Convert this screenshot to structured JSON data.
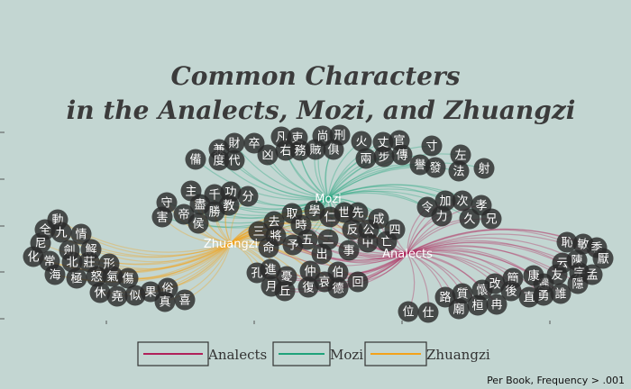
{
  "title_line1": "Common Characters",
  "title_line2": "in the Analects, Mozi, and Zhuangzi",
  "caption": "Per Book, Frequency > .001",
  "colors": {
    "background": "#c3d6d2",
    "analects": "#b0215a",
    "mozi": "#1fa37a",
    "zhuangzi": "#f3a21a",
    "node": "#2b2b2b"
  },
  "chart_data": {
    "type": "network",
    "title": "Common Characters in the Analects, Mozi, and Zhuangzi",
    "hubs": [
      "Mozi",
      "Zhuangzi",
      "Analects"
    ],
    "legend": {
      "position": "bottom",
      "entries": [
        "Analects",
        "Mozi",
        "Zhuangzi"
      ]
    },
    "groups": [
      {
        "books": [
          "Mozi"
        ],
        "characters": [
          "備",
          "兼",
          "度",
          "財",
          "代",
          "卒",
          "凶",
          "凡",
          "右",
          "吏",
          "務",
          "賊",
          "尚",
          "俱",
          "刑",
          "火",
          "兩",
          "步",
          "丈",
          "官",
          "傳",
          "寸",
          "譽",
          "發",
          "左",
          "法",
          "射"
        ]
      },
      {
        "books": [
          "Mozi",
          "Zhuangzi"
        ],
        "characters": [
          "守",
          "害",
          "帝",
          "主",
          "侯",
          "盡",
          "千",
          "勝",
          "功",
          "教",
          "分"
        ]
      },
      {
        "books": [
          "Mozi",
          "Analects"
        ],
        "characters": [
          "令",
          "加",
          "力",
          "次",
          "久",
          "孝",
          "兄"
        ]
      },
      {
        "books": [
          "Mozi",
          "Zhuangzi",
          "Analects"
        ],
        "characters": [
          "三",
          "去",
          "將",
          "命",
          "取",
          "時",
          "予",
          "學",
          "五",
          "仁",
          "世",
          "二",
          "出",
          "先",
          "反",
          "事",
          "中",
          "公",
          "成",
          "亡",
          "四"
        ]
      },
      {
        "books": [
          "Zhuangzi"
        ],
        "characters": [
          "動",
          "全",
          "九",
          "情",
          "尼",
          "劍",
          "解",
          "化",
          "常",
          "北",
          "莊",
          "形",
          "海",
          "極",
          "怒",
          "氣",
          "休",
          "傷",
          "堯",
          "似",
          "果",
          "俗",
          "真",
          "喜"
        ]
      },
      {
        "books": [
          "Zhuangzi",
          "Analects"
        ],
        "characters": [
          "孔",
          "進",
          "月",
          "憂",
          "丘",
          "仲",
          "復",
          "哀",
          "伯",
          "德",
          "回"
        ]
      },
      {
        "books": [
          "Analects"
        ],
        "characters": [
          "位",
          "仕",
          "路",
          "廟",
          "質",
          "桓",
          "懷",
          "冉",
          "改",
          "簡",
          "後",
          "直",
          "遲",
          "康",
          "勇",
          "云",
          "友",
          "誰",
          "恥",
          "陳",
          "宗",
          "隱",
          "敏",
          "季",
          "厭",
          "孟"
        ]
      }
    ]
  }
}
